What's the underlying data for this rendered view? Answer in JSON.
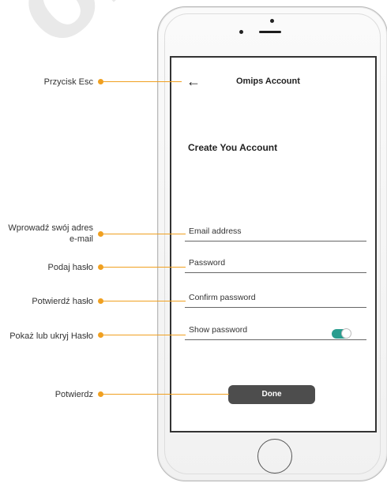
{
  "watermark": {
    "text": "onik"
  },
  "app": {
    "header_title": "Omips Account",
    "back_glyph": "←",
    "heading": "Create You Account",
    "fields": [
      {
        "label": "Email address"
      },
      {
        "label": "Password"
      },
      {
        "label": "Confirm password"
      },
      {
        "label": "Show password",
        "toggle_on": true
      }
    ],
    "done_label": "Done"
  },
  "callouts": [
    {
      "text": "Przycisk Esc"
    },
    {
      "text": "Wprowadź swój adres e-mail"
    },
    {
      "text": "Podaj hasło"
    },
    {
      "text": "Potwierdź hasło"
    },
    {
      "text": "Pokaż lub ukryj Hasło"
    },
    {
      "text": "Potwierdz"
    }
  ],
  "colors": {
    "accent": "#f0a020",
    "toggle": "#2a9d8f",
    "button": "#4d4d4d"
  },
  "icons": {
    "back": "arrow-left-icon",
    "toggle": "toggle-switch-icon"
  }
}
